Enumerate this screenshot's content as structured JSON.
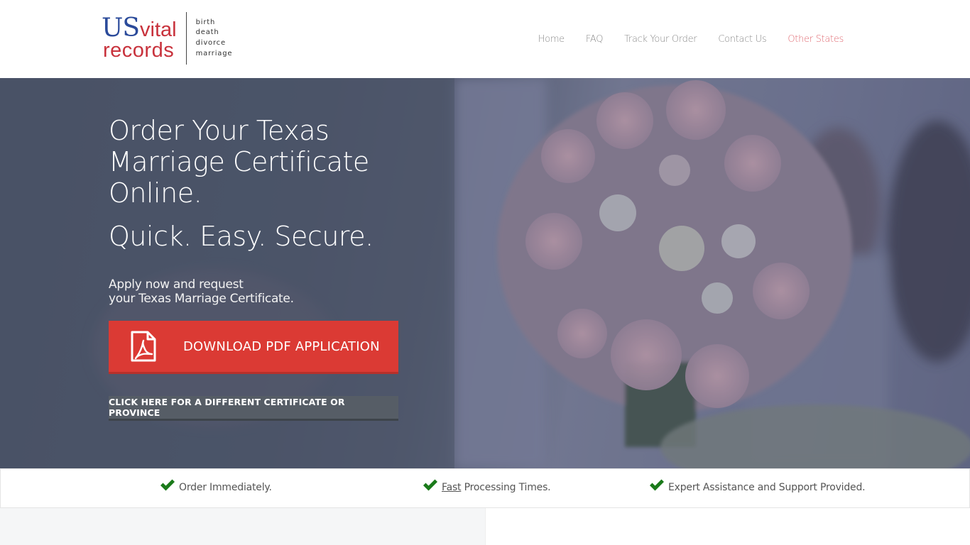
{
  "header": {
    "logo": {
      "us": "US",
      "vital": "vital",
      "records": "records",
      "record_types": [
        "birth",
        "death",
        "divorce",
        "marriage"
      ]
    },
    "nav": [
      {
        "label": "Home"
      },
      {
        "label": "FAQ"
      },
      {
        "label": "Track Your Order"
      },
      {
        "label": "Contact Us"
      },
      {
        "label": "Other States",
        "accent": true
      }
    ]
  },
  "hero": {
    "title_lines": [
      "Order Your Texas",
      "Marriage Certificate",
      "Online."
    ],
    "tagline": "Quick. Easy. Secure.",
    "subtitle_lines": [
      "Apply now and request",
      "your Texas Marriage Certificate."
    ],
    "download_button": {
      "label": "DOWNLOAD PDF APPLICATION",
      "icon": "pdf-file-icon"
    },
    "other_button": {
      "label": "CLICK HERE FOR A DIFFERENT CERTIFICATE OR PROVINCE"
    }
  },
  "features": [
    {
      "icon": "checkmark-icon",
      "underlined": "",
      "text": "Order Immediately."
    },
    {
      "icon": "checkmark-icon",
      "underlined": "Fast",
      "text": " Processing Times."
    },
    {
      "icon": "checkmark-icon",
      "underlined": "",
      "text": "Expert Assistance and Support Provided."
    }
  ],
  "colors": {
    "brand_blue": "#2a4a9a",
    "brand_red": "#c8323c",
    "nav_accent": "#e06a72",
    "cta_red": "#db3a34",
    "secondary_btn": "#565d66",
    "check_green": "#1a7a1a"
  }
}
